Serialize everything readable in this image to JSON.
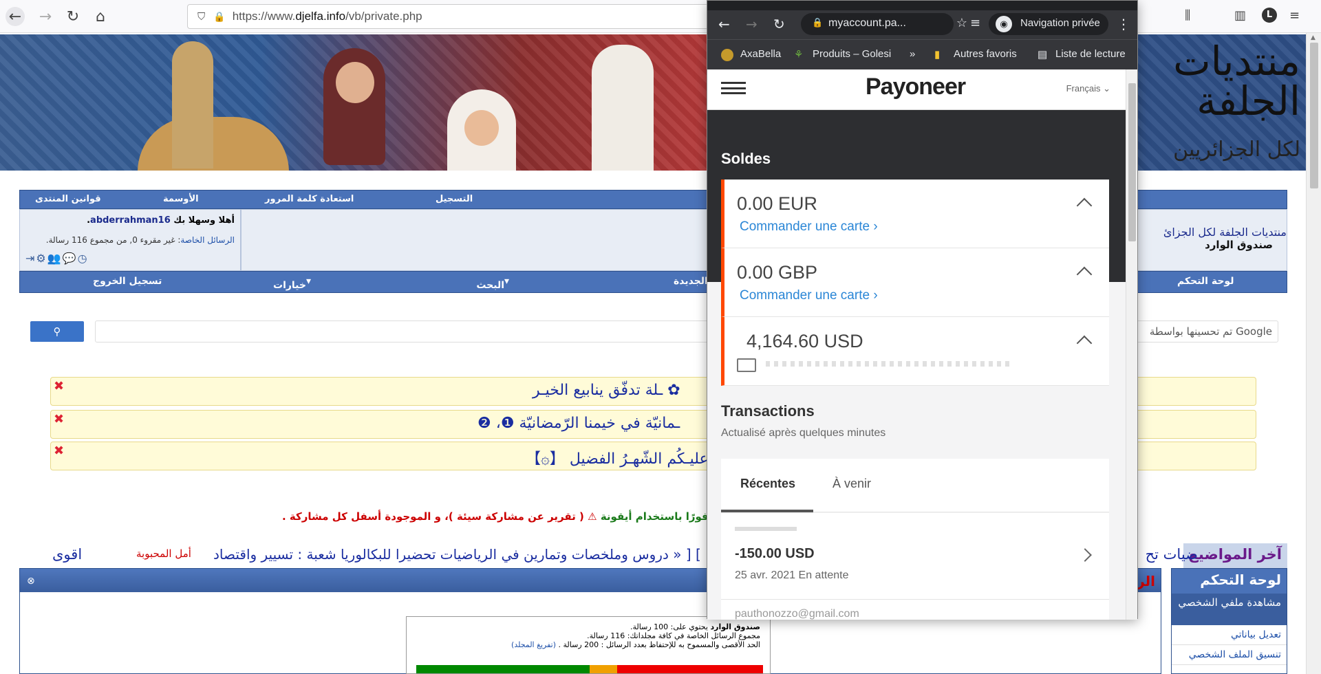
{
  "firefox": {
    "url_prefix": "https://www.",
    "url_domain": "djelfa.info",
    "url_path": "/vb/private.php",
    "avatar_letter": "L"
  },
  "forum": {
    "nav_top": {
      "rules": "قوانين المنتدى",
      "medals": "الأوسمة",
      "recover": "استعادة كلمة المرور",
      "register": "التسجيل"
    },
    "greeting": "أهلا وسهلا بك",
    "username": "abderrahman16",
    "pm_label": "الرسائل الخاصة",
    "pm_text": ": غير مقروء 0, من مجموع 116 رسالة.",
    "crumb_forum": "منتديات الجلفة لكل الجزائ",
    "crumb_inbox": "صندوق الوارد",
    "nav_bottom": {
      "logout": "تسجيل الخروج",
      "quick": "خيارات سريعة",
      "search": "البحث",
      "new_posts": "ت الجديدة",
      "cp": "لوحة التحكم"
    },
    "search_label": "تم تحسينها بواسطة Google",
    "notices": [
      "✿ ـلة تدفّق ينابيع الخيـر",
      "ـمانيّة في خيمنا الرّمضانيّة ❶، ❷",
      "ـكَ عليـكُم الشّهـرُ الفضيل 【۞】"
    ],
    "warning": "ـلاغ عنها فورًا باستخدام أيقونة",
    "warning_em": "( تقرير عن مشاركة سيئة )، و الموجودة أسفل كل مشاركة .",
    "ticker_tag": "آخر المواضيع",
    "ticker_text": "اقوى",
    "ticker_red": "أمل المحبوبة",
    "ticker_main": "] [ « دروس وملخصات وتمارين في الرياضيات تحضيرا للبكالوريا شعبة : تسيير واقتصاد",
    "ticker_frag": "ضيات تح",
    "box_title_frag": "الرس",
    "stats": {
      "line1_b": "صندوق الوارد",
      "line1": " يحتوي على: 100 رسالة.",
      "line2": "مجموع الرسائل الخاصة في كافة مجلداتك: 116 رسالة.",
      "line3": "الحد الأقصى والمسموح به للإحتفاظ بعدد الرسائل : 200 رسالة .",
      "line3_link": "(تفريغ المجلد)"
    },
    "cp_title": "لوحة التحكم",
    "cp_selected": "مشاهدة ملفي الشخصي",
    "cp_items": [
      "تعديل بياناتي",
      "تنسيق الملف الشخصي"
    ]
  },
  "chrome": {
    "omnibox": "myaccount.pa...",
    "incognito": "Navigation privée",
    "bookmarks": [
      "AxaBella",
      "Produits – Golesi",
      "Autres favoris",
      "Liste de lecture"
    ],
    "more": "»"
  },
  "payoneer": {
    "logo": "Payoneer",
    "language": "Français",
    "soldes": "Soldes",
    "balances": [
      {
        "amount": "0.00 EUR",
        "link": "Commander une carte"
      },
      {
        "amount": "0.00 GBP",
        "link": "Commander une carte"
      },
      {
        "amount": "4,164.60 USD"
      }
    ],
    "transactions_title": "Transactions",
    "updated": "Actualisé après quelques minutes",
    "tab_recent": "Récentes",
    "tab_upcoming": "À venir",
    "tx_amount": "-150.00 USD",
    "tx_date": "25 avr. 2021",
    "tx_status": "En attente",
    "tx_next": "pauthonozzo@gmail.com"
  },
  "colors": {
    "accent": "#ff4800",
    "link": "#2a86d6",
    "forum_blue": "#4a72b8"
  }
}
